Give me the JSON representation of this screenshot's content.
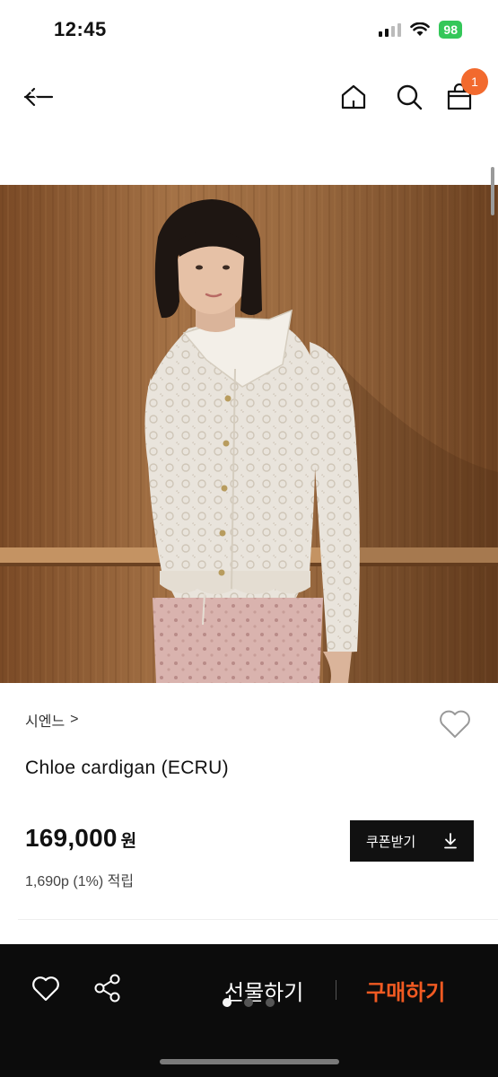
{
  "status_bar": {
    "time": "12:45",
    "battery": "98"
  },
  "nav": {
    "cart_count": "1"
  },
  "product": {
    "brand": "시엔느",
    "brand_arrow": ">",
    "name": "Chloe cardigan (ECRU)",
    "price": "169,000",
    "currency": "원",
    "points": "1,690p (1%) 적립",
    "coupon_label": "쿠폰받기"
  },
  "bottom_bar": {
    "gift_label": "선물하기",
    "buy_label": "구매하기",
    "page_dots": 3,
    "active_dot": 1
  },
  "colors": {
    "accent": "#f15a22",
    "badge": "#f26a2e",
    "dark": "#0c0c0c"
  },
  "icons": [
    "back-icon",
    "home-icon",
    "search-icon",
    "cart-icon",
    "heart-icon",
    "share-icon",
    "download-icon"
  ]
}
